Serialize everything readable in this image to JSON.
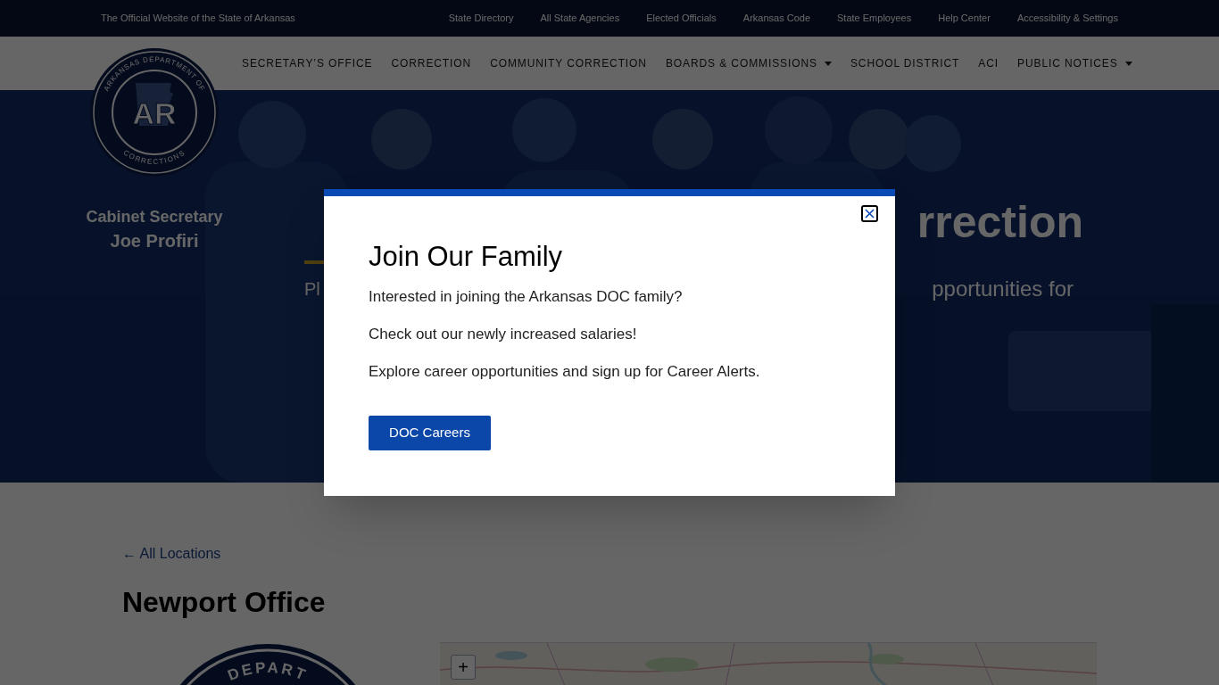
{
  "top_bar": {
    "tagline": "The Official Website of the State of Arkansas",
    "links": [
      "State Directory",
      "All State Agencies",
      "Elected Officials",
      "Arkansas Code",
      "State Employees",
      "Help Center",
      "Accessibility & Settings"
    ]
  },
  "logo": {
    "top_text": "ARKANSAS DEPARTMENT OF",
    "initials": "AR",
    "bottom_text": "CORRECTIONS"
  },
  "nav": {
    "items": [
      {
        "label": "SECRETARY’S OFFICE",
        "has_menu": false
      },
      {
        "label": "CORRECTION",
        "has_menu": false
      },
      {
        "label": "COMMUNITY CORRECTION",
        "has_menu": false
      },
      {
        "label": "BOARDS & COMMISSIONS",
        "has_menu": true
      },
      {
        "label": "SCHOOL DISTRICT",
        "has_menu": false
      },
      {
        "label": "ACI",
        "has_menu": false
      },
      {
        "label": "PUBLIC NOTICES",
        "has_menu": true
      }
    ]
  },
  "hero": {
    "secretary_title": "Cabinet Secretary",
    "secretary_name": "Joe Profiri",
    "heading_end": "rrection",
    "subtitle_line_1_start": "Pl",
    "subtitle_line_1_end": "pportunities for"
  },
  "modal": {
    "title": "Join Our Family",
    "paragraphs": [
      "Interested in joining the Arkansas DOC family?",
      "Check out our newly increased salaries!",
      "Explore career opportunities and sign up for Career Alerts."
    ],
    "button": "DOC Careers"
  },
  "location": {
    "back_link": "← All Locations",
    "title": "Newport Office",
    "seal_text": "DEPART"
  },
  "map": {
    "zoom_in": "+"
  }
}
